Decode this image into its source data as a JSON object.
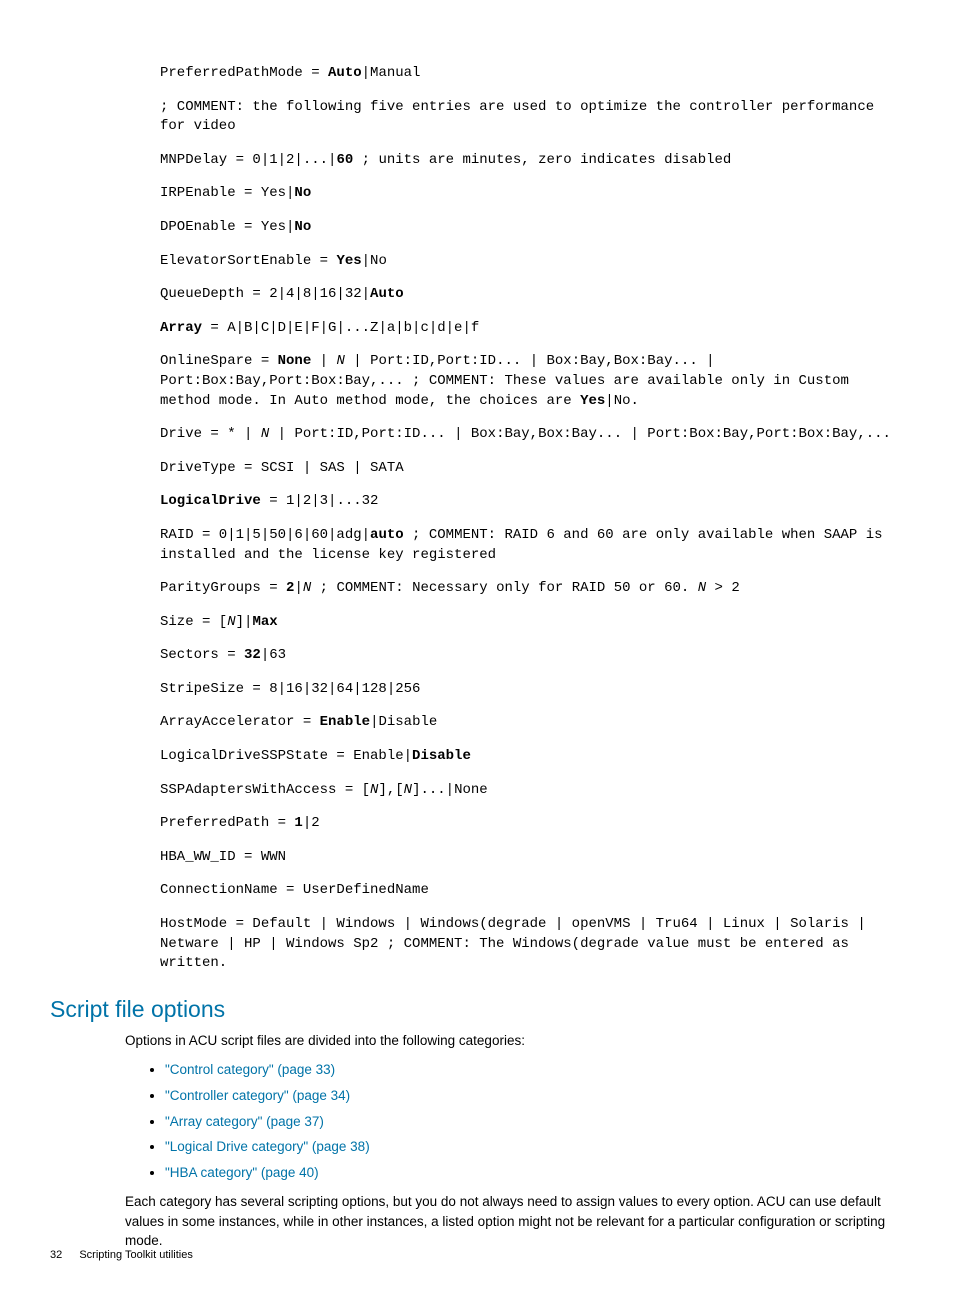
{
  "mono": {
    "l1_a": "PreferredPathMode = ",
    "l1_b": "Auto",
    "l1_c": "|Manual",
    "l2": "; COMMENT: the following five entries are used to optimize the controller performance for video",
    "l3_a": "MNPDelay = 0|1|2|...|",
    "l3_b": "60",
    "l3_c": " ; units are minutes, zero indicates disabled",
    "l4_a": "IRPEnable = Yes|",
    "l4_b": "No",
    "l5_a": "DPOEnable = Yes|",
    "l5_b": "No",
    "l6_a": "ElevatorSortEnable = ",
    "l6_b": "Yes",
    "l6_c": "|No",
    "l7_a": "QueueDepth = 2|4|8|16|32|",
    "l7_b": "Auto",
    "l8_a": "Array",
    "l8_b": " = A|B|C|D|E|F|G|...Z|a|b|c|d|e|f",
    "l9_a": "OnlineSpare = ",
    "l9_b": "None",
    "l9_c": " | ",
    "l9_d": "N",
    "l9_e": " | Port:ID,Port:ID... | Box:Bay,Box:Bay... | Port:Box:Bay,Port:Box:Bay,... ; COMMENT: These values are available only in Custom method mode. In Auto method mode, the choices are ",
    "l9_f": "Yes",
    "l9_g": "|No.",
    "l10_a": "Drive = * | ",
    "l10_b": "N",
    "l10_c": " | Port:ID,Port:ID... | Box:Bay,Box:Bay... | Port:Box:Bay,Port:Box:Bay,...",
    "l11": "DriveType = SCSI | SAS | SATA",
    "l12_a": "LogicalDrive",
    "l12_b": " = 1|2|3|...32",
    "l13_a": "RAID = 0|1|5|50|6|60|adg|",
    "l13_b": "auto",
    "l13_c": " ; COMMENT: RAID 6 and 60 are only available when SAAP is installed and the license key registered",
    "l14_a": "ParityGroups = ",
    "l14_b": "2",
    "l14_c": "|",
    "l14_d": "N",
    "l14_e": " ; COMMENT: Necessary only for RAID 50 or 60. ",
    "l14_f": "N",
    "l14_g": " > 2",
    "l15_a": "Size = [",
    "l15_b": "N",
    "l15_c": "]|",
    "l15_d": "Max",
    "l16_a": "Sectors = ",
    "l16_b": "32",
    "l16_c": "|63",
    "l17": "StripeSize = 8|16|32|64|128|256",
    "l18_a": "ArrayAccelerator = ",
    "l18_b": "Enable",
    "l18_c": "|Disable",
    "l19_a": "LogicalDriveSSPState = Enable|",
    "l19_b": "Disable",
    "l20_a": "SSPAdaptersWithAccess = [",
    "l20_b": "N",
    "l20_c": "],[",
    "l20_d": "N",
    "l20_e": "]...|None",
    "l21_a": "PreferredPath = ",
    "l21_b": "1",
    "l21_c": "|2",
    "l22": "HBA_WW_ID = WWN",
    "l23": "ConnectionName = UserDefinedName",
    "l24": "HostMode = Default | Windows | Windows(degrade | openVMS | Tru64 | Linux | Solaris | Netware | HP | Windows Sp2 ; COMMENT: The Windows(degrade value must be entered as written."
  },
  "section_heading": "Script file options",
  "intro": "Options in ACU script files are divided into the following categories:",
  "links": [
    "\"Control category\" (page 33)",
    "\"Controller category\" (page 34)",
    "\"Array category\" (page 37)",
    "\"Logical Drive category\" (page 38)",
    "\"HBA category\" (page 40)"
  ],
  "outro": "Each category has several scripting options, but you do not always need to assign values to every option. ACU can use default values in some instances, while in other instances, a listed option might not be relevant for a particular configuration or scripting mode.",
  "footer": {
    "page": "32",
    "title": "Scripting Toolkit utilities"
  }
}
